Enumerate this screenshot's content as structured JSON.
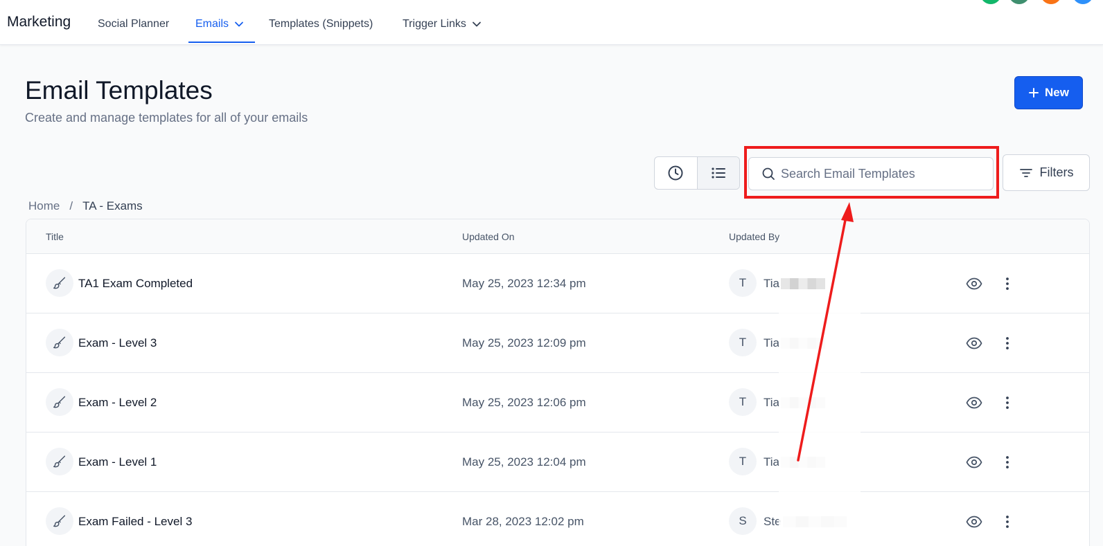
{
  "nav": {
    "brand": "Marketing",
    "links": [
      {
        "label": "Social Planner"
      },
      {
        "label": "Emails"
      },
      {
        "label": "Templates (Snippets)"
      },
      {
        "label": "Trigger Links"
      }
    ],
    "avatar_colors": [
      "#12b76a",
      "#3f8f6f",
      "#f97316",
      "#2e90fa"
    ]
  },
  "header": {
    "title": "Email Templates",
    "subtitle": "Create and manage templates for all of your emails",
    "new_label": "New"
  },
  "toolbar": {
    "search_placeholder": "Search Email Templates",
    "filters_label": "Filters"
  },
  "breadcrumb": {
    "home": "Home",
    "separator": "/",
    "current": "TA - Exams"
  },
  "table": {
    "columns": [
      "Title",
      "Updated On",
      "Updated By"
    ],
    "rows": [
      {
        "title": "TA1 Exam Completed",
        "updated_on": "May 25, 2023 12:34 pm",
        "initial": "T",
        "name": "Tia"
      },
      {
        "title": "Exam - Level 3",
        "updated_on": "May 25, 2023 12:09 pm",
        "initial": "T",
        "name": "Tia"
      },
      {
        "title": "Exam - Level 2",
        "updated_on": "May 25, 2023 12:06 pm",
        "initial": "T",
        "name": "Tia"
      },
      {
        "title": "Exam - Level 1",
        "updated_on": "May 25, 2023 12:04 pm",
        "initial": "T",
        "name": "Tia"
      },
      {
        "title": "Exam Failed - Level 3",
        "updated_on": "Mar 28, 2023 12:02 pm",
        "initial": "S",
        "name": "Ste"
      }
    ]
  },
  "colors": {
    "accent": "#155eef",
    "highlight": "#ee1c1c"
  }
}
